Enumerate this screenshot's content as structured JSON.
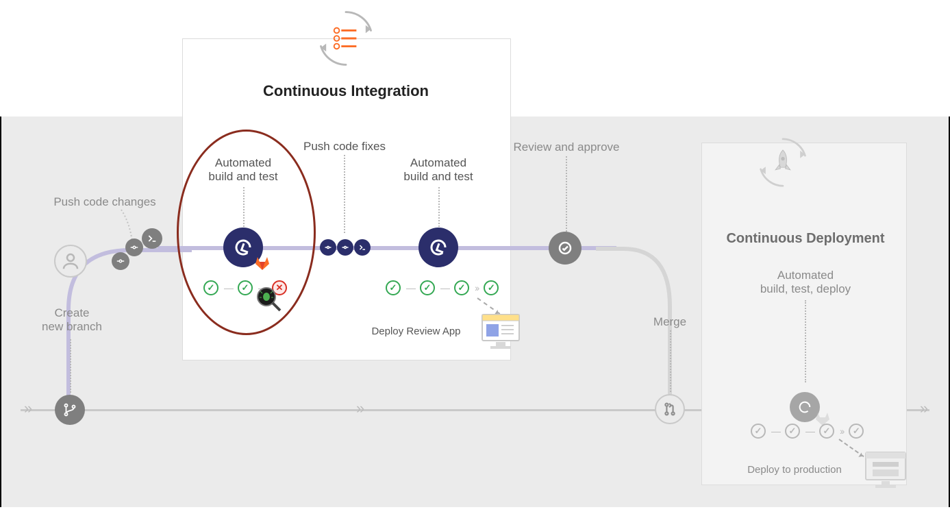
{
  "sections": {
    "ci_title": "Continuous Integration",
    "cd_title": "Continuous Deployment"
  },
  "labels": {
    "create_branch": "Create\nnew branch",
    "push_changes": "Push code changes",
    "auto_build_test_1": "Automated\nbuild and test",
    "push_fixes": "Push code fixes",
    "auto_build_test_2": "Automated\nbuild and test",
    "deploy_review": "Deploy Review App",
    "review_approve": "Review and approve",
    "merge": "Merge",
    "auto_build_test_deploy": "Automated\nbuild, test, deploy",
    "deploy_prod": "Deploy to production"
  },
  "icons": {
    "user": "user-icon",
    "branch": "git-branch-icon",
    "commit": "git-commit-icon",
    "terminal": "terminal-icon",
    "cycle": "cycle-icon",
    "check_badge": "check-badge-icon",
    "merge_request": "merge-request-icon",
    "gitlab": "gitlab-tanuki-icon",
    "bug_search": "bug-magnifier-icon",
    "monitor": "monitor-review-icon",
    "rocket": "rocket-icon",
    "checklist": "checklist-icon"
  },
  "pipeline": {
    "run1": [
      "ok",
      "ok",
      "bad"
    ],
    "run2": [
      "ok",
      "ok",
      "ok",
      "sep",
      "ok"
    ],
    "run3": [
      "ok",
      "ok",
      "ok",
      "sep",
      "ok"
    ]
  },
  "colors": {
    "accent_navy": "#2b2e6b",
    "accent_green": "#34a853",
    "accent_red": "#d93025",
    "accent_orange": "#fc6d26",
    "highlight_ring": "#8a2c1e",
    "muted_gray": "#8a8a8a",
    "bg_gray": "#ebebeb"
  }
}
